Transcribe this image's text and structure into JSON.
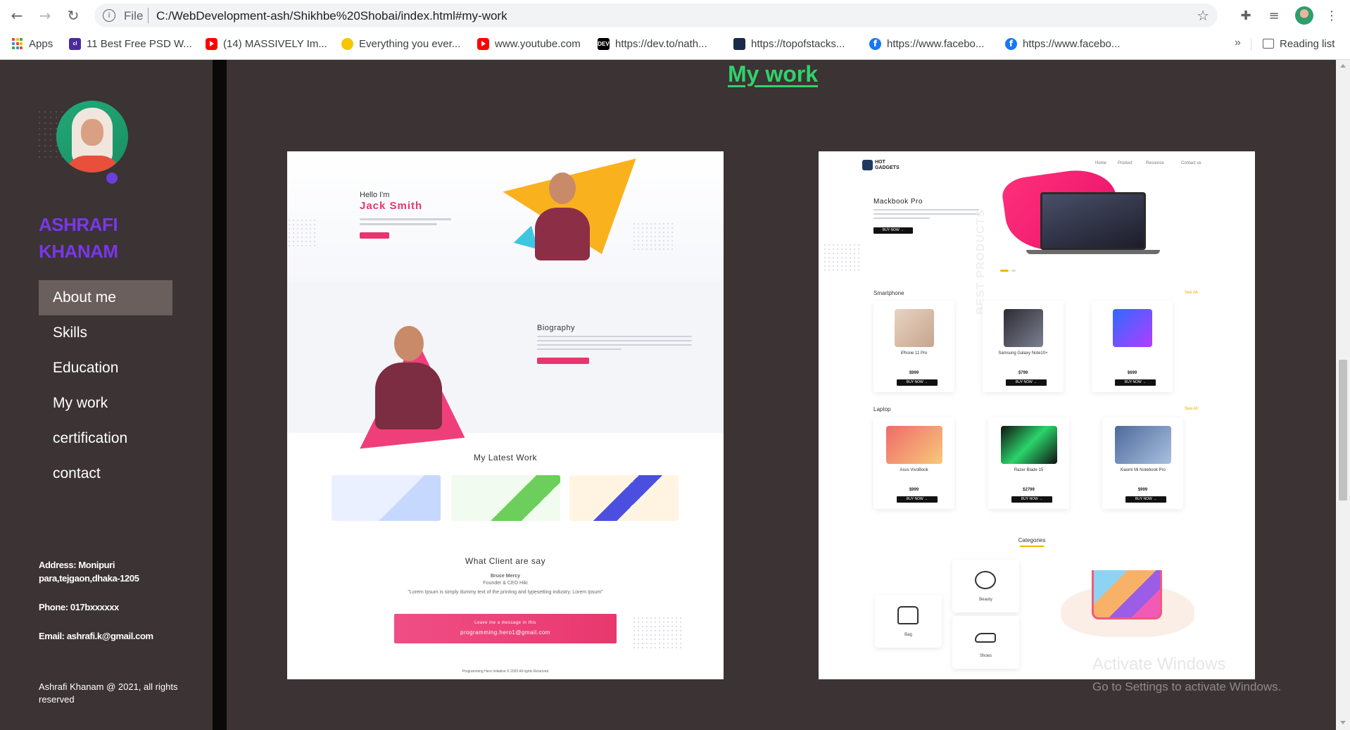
{
  "browser": {
    "url_scheme": "File",
    "url": "C:/WebDevelopment-ash/Shikhbe%20Shobai/index.html#my-work",
    "bookmarks": [
      {
        "label": "Apps",
        "icon": "apps-grid-icon"
      },
      {
        "label": "11 Best Free PSD W...",
        "icon": "colorlib-favicon"
      },
      {
        "label": "(14) MASSIVELY Im...",
        "icon": "youtube-favicon"
      },
      {
        "label": "Everything you ever...",
        "icon": "lightbulb-favicon"
      },
      {
        "label": "www.youtube.com",
        "icon": "youtube-favicon"
      },
      {
        "label": "https://dev.to/nath...",
        "icon": "dev-favicon"
      },
      {
        "label": "https://topofstacks...",
        "icon": "stack-favicon"
      },
      {
        "label": "https://www.facebo...",
        "icon": "facebook-favicon"
      },
      {
        "label": "https://www.facebo...",
        "icon": "facebook-favicon"
      }
    ],
    "bookmarks_more": "»",
    "reading_list": "Reading list"
  },
  "sidebar": {
    "name_line1": "ASHRAFI",
    "name_line2": "KHANAM",
    "nav": [
      {
        "label": "About me",
        "active": true
      },
      {
        "label": "Skills",
        "active": false
      },
      {
        "label": "Education",
        "active": false
      },
      {
        "label": "My work",
        "active": false
      },
      {
        "label": "certification",
        "active": false
      },
      {
        "label": "contact",
        "active": false
      }
    ],
    "address": "Address: Monipuri para,tejgaon,dhaka-1205",
    "phone": "Phone: 017bxxxxxx",
    "email": "Email: ashrafi.k@gmail.com",
    "copyright": "Ashrafi Khanam @ 2021, all rights reserved"
  },
  "main": {
    "section_title": "My work",
    "portfolio_preview": {
      "hello": "Hello I'm",
      "name": "Jack Smith",
      "bio_title": "Biography",
      "latest_work_title": "My Latest Work",
      "clients_title": "What Client are say",
      "client_name": "Bruce Mercy",
      "client_role": "Founder & CEO Hiki",
      "client_quote": "\"Lorem Ipsum is simply dummy text of the printing and typesetting industry. Lorem Ipsum\"",
      "cta_small": "Leave me a message in this",
      "cta_email": "programming.hero1@gmail.com",
      "footer": "Programming Hero Initiative © 2020 All rights Reserved"
    },
    "shop_preview": {
      "logo": "HOT GADGETS",
      "nav": [
        "Home",
        "Product",
        "Resource",
        "Contact us"
      ],
      "hero_title": "Mackbook Pro",
      "hero_btn": "BUY NOW →",
      "side_text": "BEST PRODUCTS",
      "smartphone_title": "Smartphone",
      "laptop_title": "Laptop",
      "see_all": "See All",
      "smartphones": [
        {
          "name": "iPhone 11 Pro",
          "price": "$999"
        },
        {
          "name": "Samsung Galaxy Note10+",
          "price": "$799"
        },
        {
          "name": "",
          "price": "$699"
        }
      ],
      "laptops": [
        {
          "name": "Asus VivoBook",
          "price": "$999"
        },
        {
          "name": "Razer Blade 15",
          "price": "$2799"
        },
        {
          "name": "Xiaomi Mi Notebook Pro",
          "price": "$999"
        }
      ],
      "buy_now": "BUY NOW →",
      "categories_title": "Categories",
      "categories": [
        "Bag",
        "Beauty",
        "Shoes"
      ]
    }
  },
  "windows_watermark": {
    "line1": "Activate Windows",
    "line2": "Go to Settings to activate Windows."
  },
  "colors": {
    "page_bg": "#3b3334",
    "name_accent": "#7a37e8",
    "title_green": "#2fd36a",
    "nav_active_bg": "#6a5f5d",
    "portfolio_pink": "#e6366f"
  }
}
